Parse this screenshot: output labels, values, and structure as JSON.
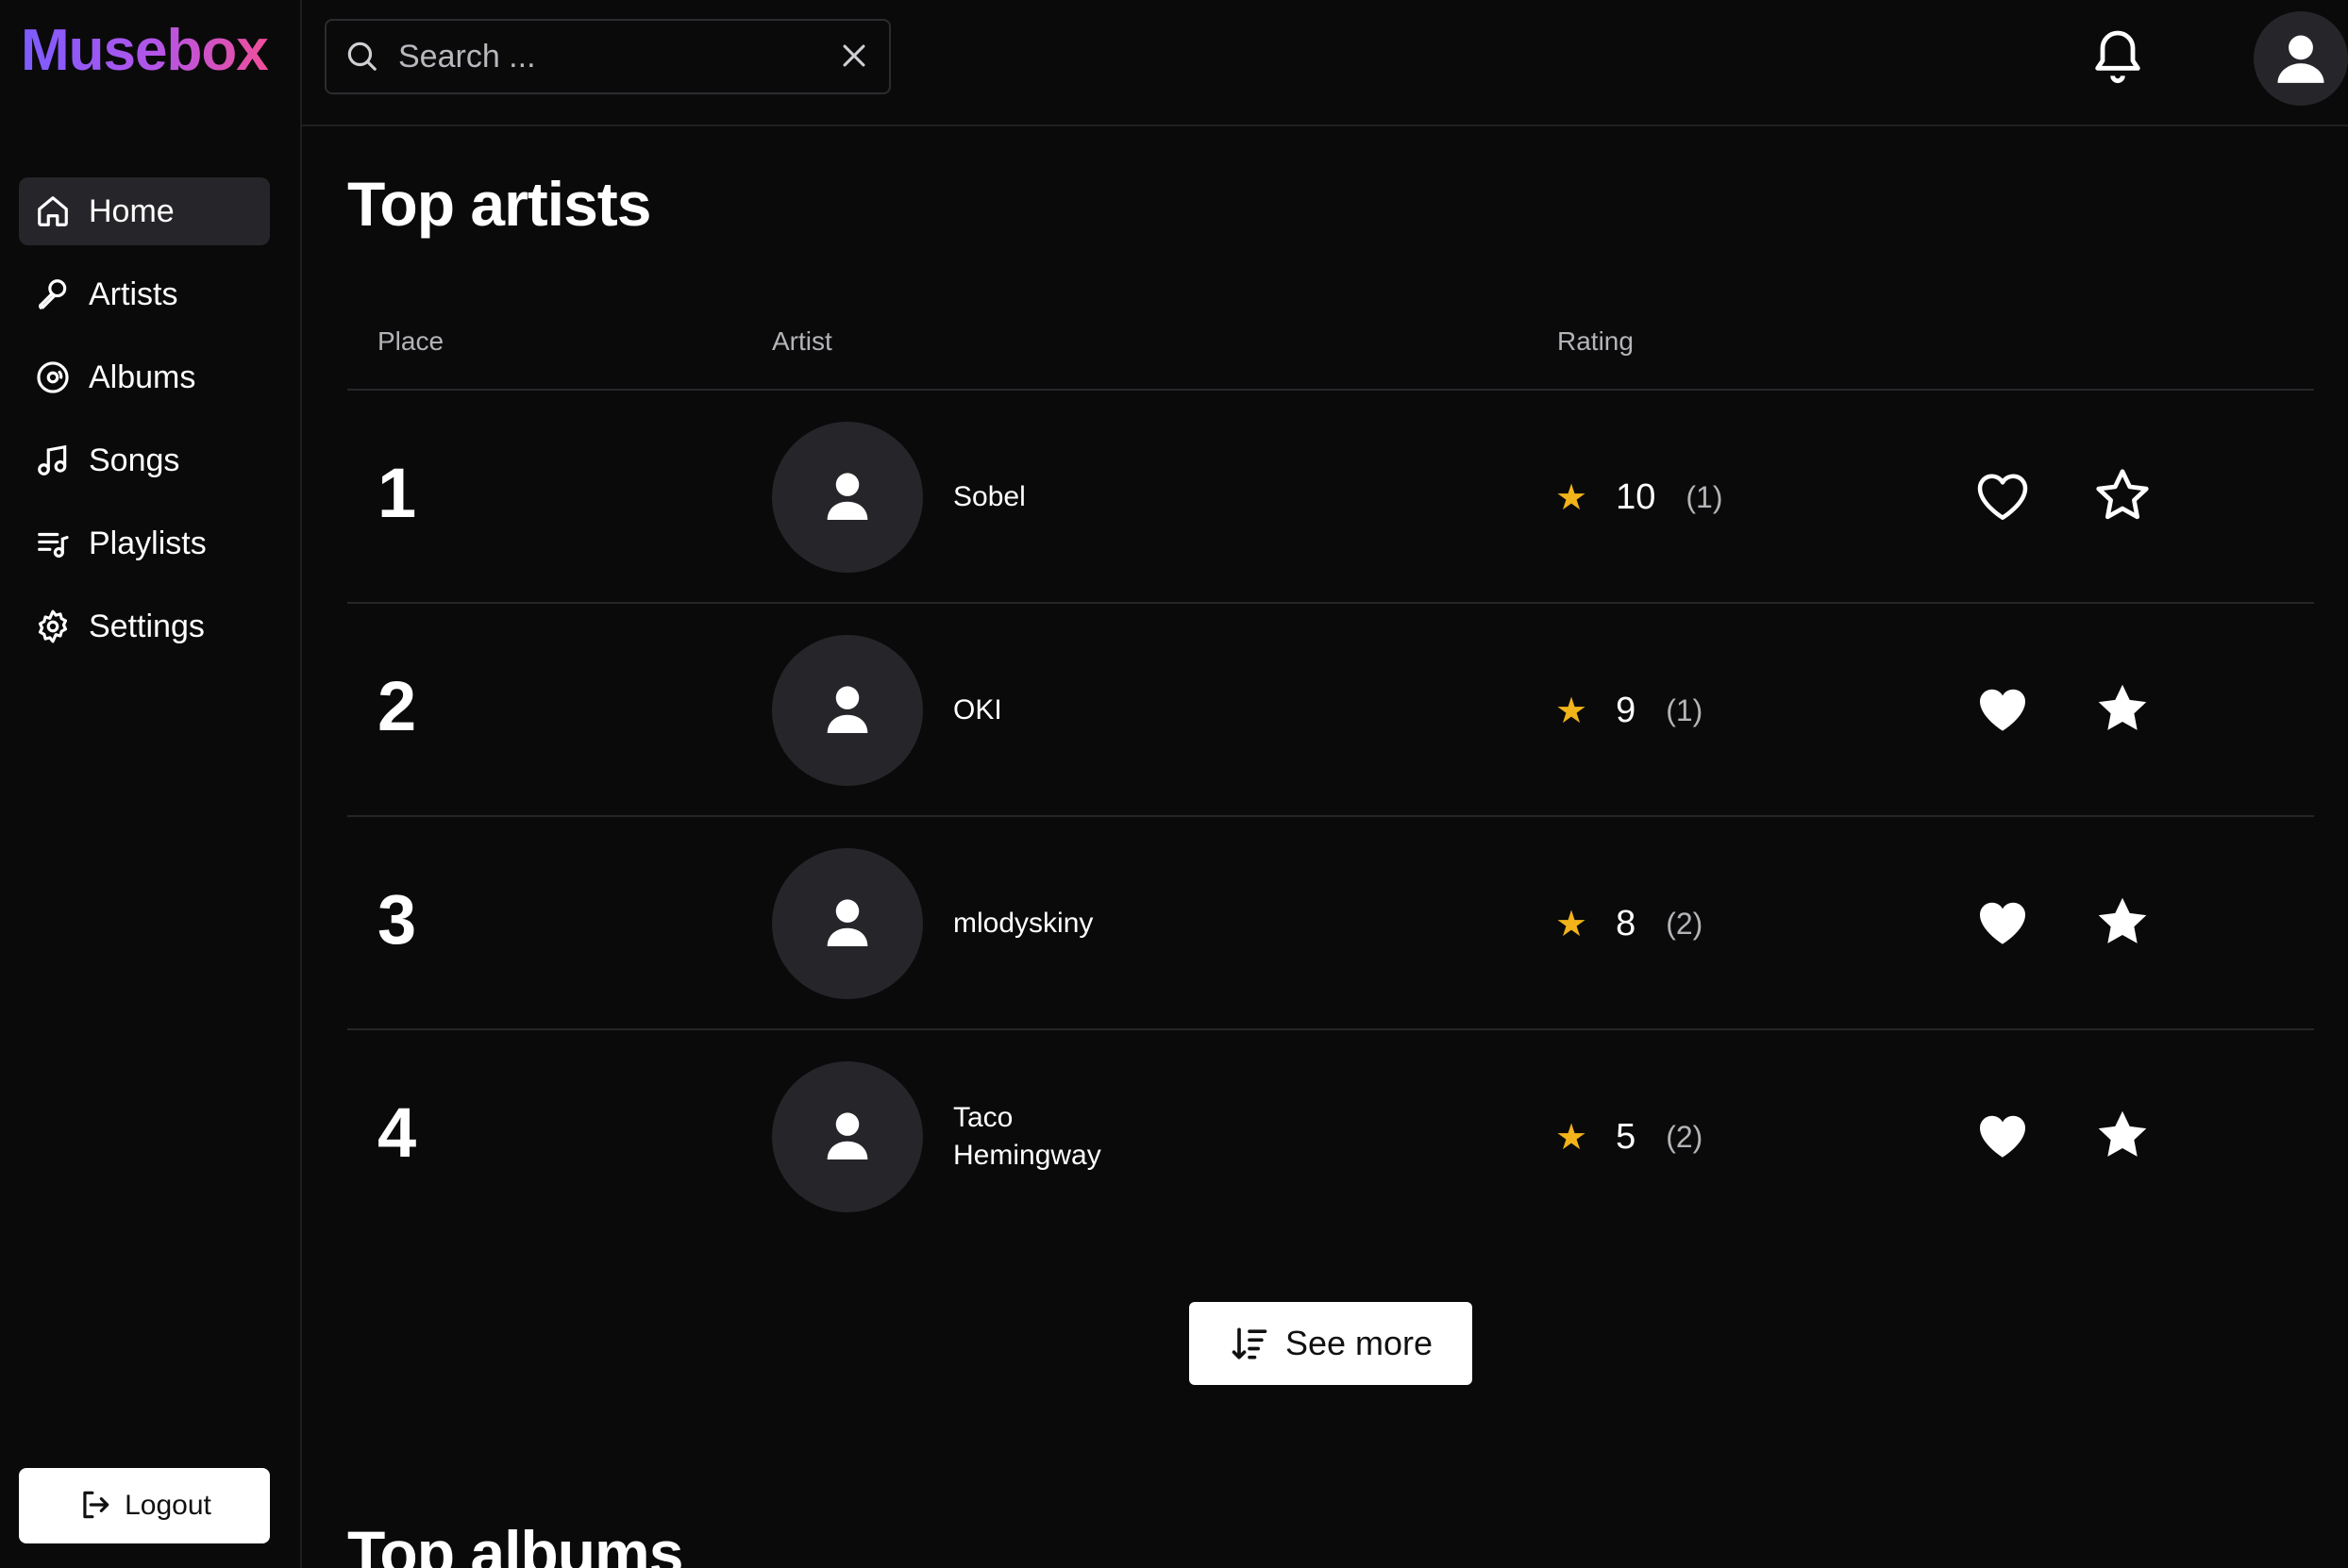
{
  "app": {
    "logo": "Musebox"
  },
  "sidebar": {
    "items": [
      {
        "label": "Home",
        "icon": "home-icon",
        "active": true
      },
      {
        "label": "Artists",
        "icon": "microphone-icon"
      },
      {
        "label": "Albums",
        "icon": "disc-icon"
      },
      {
        "label": "Songs",
        "icon": "music-note-icon"
      },
      {
        "label": "Playlists",
        "icon": "playlist-icon"
      },
      {
        "label": "Settings",
        "icon": "gear-icon"
      }
    ],
    "logout_label": "Logout"
  },
  "topbar": {
    "search": {
      "placeholder": "Search ...",
      "value": ""
    }
  },
  "main": {
    "title": "Top artists",
    "columns": {
      "place": "Place",
      "artist": "Artist",
      "rating": "Rating"
    },
    "rows": [
      {
        "place": "1",
        "name": "Sobel",
        "rating": "10",
        "votes": "(1)",
        "liked": false,
        "favorited": false
      },
      {
        "place": "2",
        "name": "OKI",
        "rating": "9",
        "votes": "(1)",
        "liked": true,
        "favorited": true
      },
      {
        "place": "3",
        "name": "mlodyskiny",
        "rating": "8",
        "votes": "(2)",
        "liked": true,
        "favorited": true
      },
      {
        "place": "4",
        "name": "Taco Hemingway",
        "rating": "5",
        "votes": "(2)",
        "liked": true,
        "favorited": true
      }
    ],
    "see_more_label": "See more",
    "next_section_title": "Top albums"
  },
  "colors": {
    "accent_star": "#f2b31b",
    "logo_start": "#7c5cff",
    "logo_end": "#ef4f9a"
  }
}
